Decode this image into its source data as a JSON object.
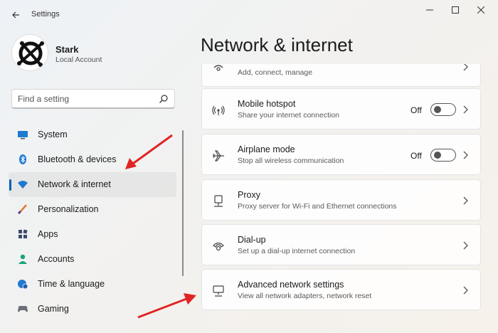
{
  "window": {
    "title": "Settings",
    "back_icon": "arrow-left-icon",
    "controls": [
      "minimize-icon",
      "maximize-icon",
      "close-icon"
    ]
  },
  "profile": {
    "name": "Stark",
    "account_type": "Local Account"
  },
  "search": {
    "placeholder": "Find a setting",
    "value": ""
  },
  "sidebar": {
    "items": [
      {
        "label": "System",
        "icon": "monitor-icon",
        "selected": false
      },
      {
        "label": "Bluetooth & devices",
        "icon": "bluetooth-icon",
        "selected": false
      },
      {
        "label": "Network & internet",
        "icon": "wifi-icon",
        "selected": true
      },
      {
        "label": "Personalization",
        "icon": "brush-icon",
        "selected": false
      },
      {
        "label": "Apps",
        "icon": "apps-icon",
        "selected": false
      },
      {
        "label": "Accounts",
        "icon": "person-icon",
        "selected": false
      },
      {
        "label": "Time & language",
        "icon": "globe-clock-icon",
        "selected": false
      },
      {
        "label": "Gaming",
        "icon": "gamepad-icon",
        "selected": false
      }
    ]
  },
  "main": {
    "page_title": "Network & internet",
    "cards": [
      {
        "title": "",
        "description": "Add, connect, manage",
        "icon": "vpn-icon"
      },
      {
        "title": "Mobile hotspot",
        "description": "Share your internet connection",
        "icon": "hotspot-icon",
        "toggle": "Off"
      },
      {
        "title": "Airplane mode",
        "description": "Stop all wireless communication",
        "icon": "airplane-icon",
        "toggle": "Off"
      },
      {
        "title": "Proxy",
        "description": "Proxy server for Wi-Fi and Ethernet connections",
        "icon": "proxy-icon"
      },
      {
        "title": "Dial-up",
        "description": "Set up a dial-up internet connection",
        "icon": "dialup-icon"
      },
      {
        "title": "Advanced network settings",
        "description": "View all network adapters, network reset",
        "icon": "network-adapter-icon"
      }
    ]
  },
  "colors": {
    "accent": "#005fb8",
    "annotation_arrow": "#e02424"
  }
}
